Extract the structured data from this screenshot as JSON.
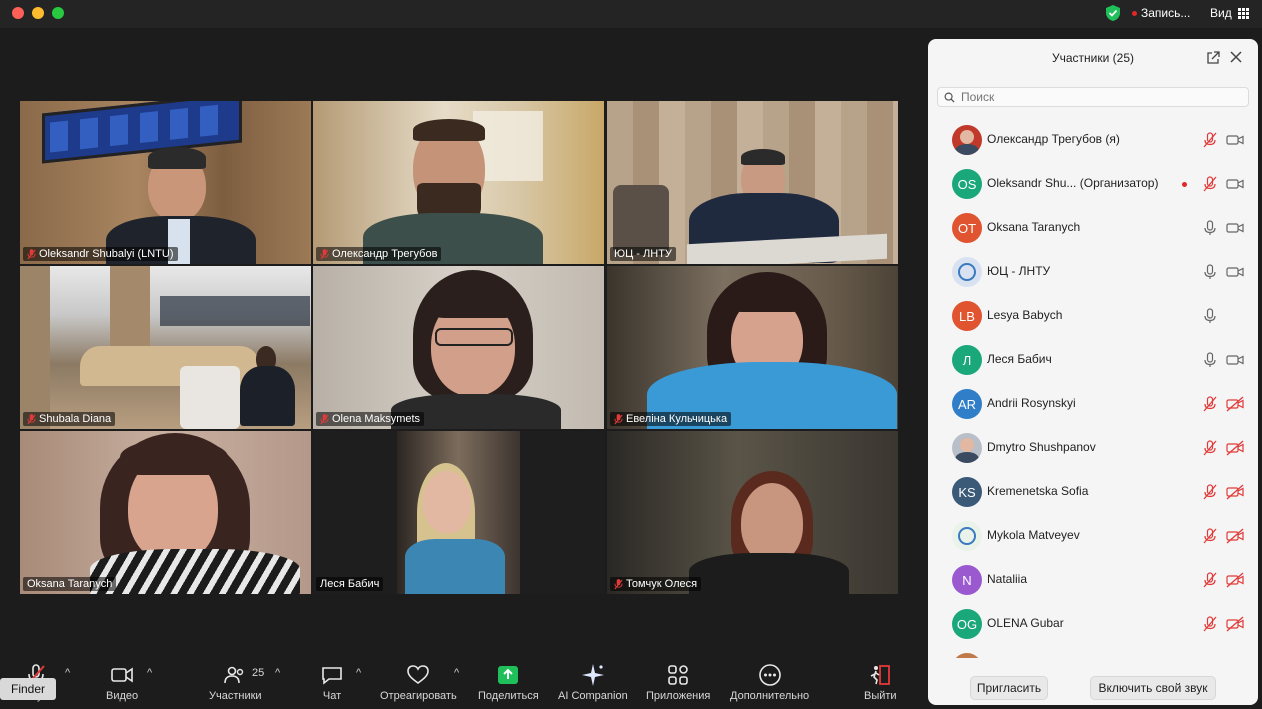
{
  "titlebar": {
    "recording_label": "Запись...",
    "view_label": "Вид"
  },
  "tiles": [
    {
      "name": "Oleksandr Shubalyi (LNTU)",
      "muted": true
    },
    {
      "name": "Олександр Трегубов",
      "muted": true
    },
    {
      "name": "ЮЦ - ЛНТУ",
      "muted": false,
      "active_speaker": true
    },
    {
      "name": "Shubala Diana",
      "muted": true
    },
    {
      "name": "Olena Maksymets",
      "muted": true
    },
    {
      "name": "Евеліна Кульчицька",
      "muted": true
    },
    {
      "name": "Oksana Taranych",
      "muted": false
    },
    {
      "name": "Леся Бабич",
      "muted": false
    },
    {
      "name": "Томчук Олеся",
      "muted": true
    }
  ],
  "toolbar": {
    "audio_label": "Звук",
    "video_label": "Видео",
    "participants_label": "Участники",
    "participants_count": "25",
    "chat_label": "Чат",
    "react_label": "Отреагировать",
    "share_label": "Поделиться",
    "ai_label": "AI Companion",
    "apps_label": "Приложения",
    "more_label": "Дополнительно",
    "leave_label": "Выйти"
  },
  "finder_tooltip": "Finder",
  "panel": {
    "title": "Участники (25)",
    "search_placeholder": "Поиск",
    "participants": [
      {
        "name": "Олександр Трегубов (я)",
        "initials": "",
        "avatar": "photo",
        "color": "#c0392b",
        "mic": "muted",
        "cam": "on"
      },
      {
        "name": "Oleksandr Shu...",
        "tag": "(Организатор)",
        "initials": "OS",
        "avatar": "initials",
        "color": "#1aa87a",
        "mic": "muted",
        "cam": "on",
        "recording": true
      },
      {
        "name": "Oksana Taranych",
        "initials": "OT",
        "avatar": "initials",
        "color": "#e0542f",
        "mic": "on",
        "cam": "on"
      },
      {
        "name": "ЮЦ - ЛНТУ",
        "initials": "",
        "avatar": "logo",
        "color": "#d8e2f0",
        "mic": "on",
        "cam": "on"
      },
      {
        "name": "Lesya Babych",
        "initials": "LB",
        "avatar": "initials",
        "color": "#e0542f",
        "mic": "on",
        "cam": "none"
      },
      {
        "name": "Леся Бабич",
        "initials": "Л",
        "avatar": "initials",
        "color": "#1aa87a",
        "mic": "on",
        "cam": "on"
      },
      {
        "name": "Andrii Rosynskyi",
        "initials": "AR",
        "avatar": "initials",
        "color": "#2f7ec7",
        "mic": "muted",
        "cam": "off"
      },
      {
        "name": "Dmytro Shushpanov",
        "initials": "",
        "avatar": "photo",
        "color": "#b8bfc8",
        "mic": "muted",
        "cam": "off"
      },
      {
        "name": "Kremenetska Sofia",
        "initials": "KS",
        "avatar": "initials",
        "color": "#3a5a78",
        "mic": "muted",
        "cam": "off"
      },
      {
        "name": "Mykola Matveyev",
        "initials": "",
        "avatar": "logo",
        "color": "#e9f3e9",
        "mic": "muted",
        "cam": "off"
      },
      {
        "name": "Nataliia",
        "initials": "N",
        "avatar": "initials",
        "color": "#9b59d0",
        "mic": "muted",
        "cam": "off"
      },
      {
        "name": "OLENA Gubar",
        "initials": "OG",
        "avatar": "initials",
        "color": "#1aa87a",
        "mic": "muted",
        "cam": "off"
      }
    ],
    "invite_label": "Пригласить",
    "unmute_label": "Включить свой звук"
  }
}
